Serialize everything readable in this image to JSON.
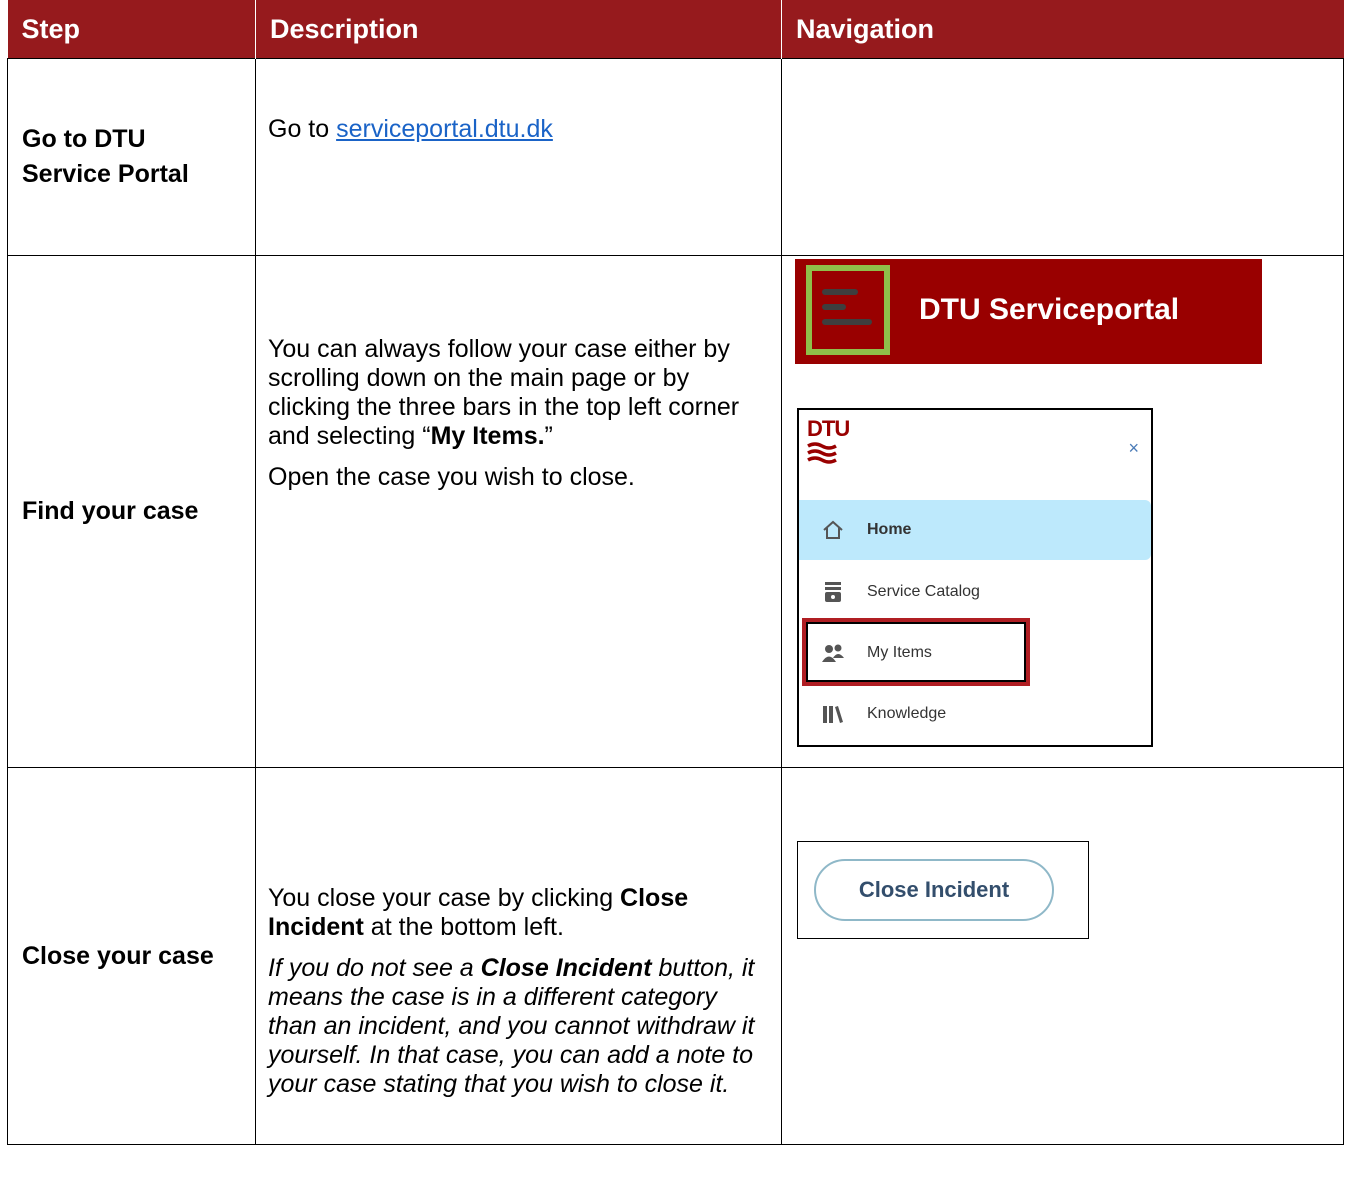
{
  "table": {
    "headers": [
      "Step",
      "Description",
      "Navigation"
    ],
    "rows": [
      {
        "step": "Go to DTU Service Portal",
        "desc_prefix": "Go to ",
        "desc_link": "serviceportal.dtu.dk"
      },
      {
        "step": "Find your case",
        "desc_p1_a": "You can always follow your case either by scrolling down on the main page or by clicking the three bars in the top left corner and selecting “",
        "desc_p1_bold": "My Items.",
        "desc_p1_b": "”",
        "desc_p2": "Open the case you wish to close."
      },
      {
        "step": "Close your case",
        "desc_p1_a": "You close your case by clicking ",
        "desc_p1_bold": "Close Incident",
        "desc_p1_b": " at the bottom left.",
        "desc_p2_a": "If you do not see a ",
        "desc_p2_bold": "Close Incident",
        "desc_p2_b": " button, it means the case is in a different category than an incident, and you cannot withdraw it yourself. In that case, you can add a note to your case stating that you wish to close it."
      }
    ]
  },
  "nav_images": {
    "portal_header": {
      "title": "DTU Serviceportal",
      "icon": "hamburger-menu-icon"
    },
    "menu": {
      "logo_text": "DTU",
      "close": "×",
      "items": [
        {
          "label": "Home",
          "icon": "home-icon"
        },
        {
          "label": "Service Catalog",
          "icon": "catalog-icon"
        },
        {
          "label": "My Items",
          "icon": "my-items-icon"
        },
        {
          "label": "Knowledge",
          "icon": "knowledge-icon"
        }
      ]
    },
    "close_button": {
      "label": "Close Incident"
    }
  },
  "colors": {
    "header_bg": "#961a1d",
    "portal_red": "#990000",
    "highlight_green": "#8fbf4a",
    "highlight_red": "#b01e23",
    "link_blue": "#1a63c7"
  }
}
